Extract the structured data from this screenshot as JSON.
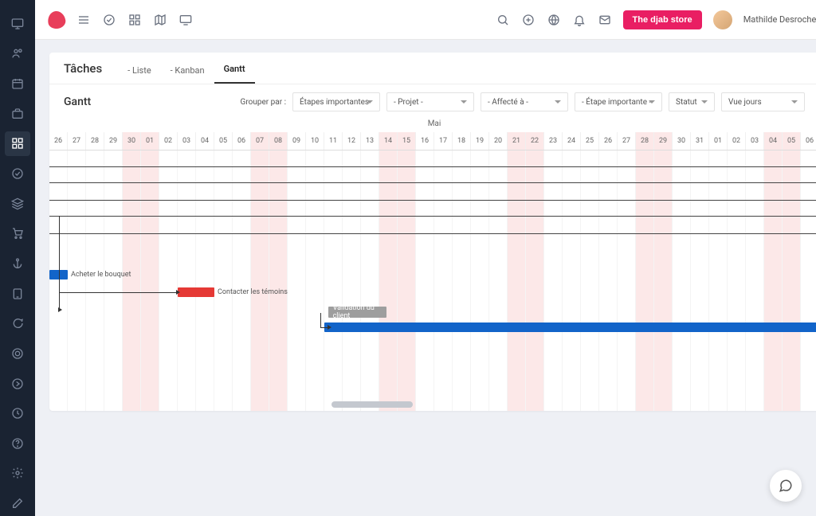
{
  "colors": {
    "accent": "#e91e63",
    "bar_blue": "#1264c9",
    "bar_red": "#e53935",
    "bar_gray": "#9e9e9e"
  },
  "header": {
    "store_button": "The djab store",
    "user_name": "Mathilde Desroches"
  },
  "sidebar_icons": [
    "monitor-icon",
    "users-icon",
    "calendar-icon",
    "briefcase-icon",
    "grid-icon",
    "check-circle-icon",
    "layers-icon",
    "cart-icon",
    "anchor-icon",
    "tablet-icon",
    "chat-icon",
    "globe-icon",
    "arrow-right-icon",
    "pie-icon",
    "help-icon",
    "settings-icon",
    "edit-icon"
  ],
  "page": {
    "title": "Tâches",
    "tabs": [
      {
        "label": "- Liste",
        "active": false
      },
      {
        "label": "- Kanban",
        "active": false
      },
      {
        "label": "Gantt",
        "active": true
      }
    ],
    "gantt_title": "Gantt"
  },
  "controls": {
    "group_by_label": "Grouper par :",
    "milestone": "Étapes importantes",
    "project": "- Projet -",
    "assignee": "- Affecté à -",
    "milestone2": "- Étape importante -",
    "status": "Statut",
    "view": "Vue jours"
  },
  "timeline": {
    "month": "Mai",
    "days": [
      "26",
      "27",
      "28",
      "29",
      "30",
      "01",
      "02",
      "03",
      "04",
      "05",
      "06",
      "07",
      "08",
      "09",
      "10",
      "11",
      "12",
      "13",
      "14",
      "15",
      "16",
      "17",
      "18",
      "19",
      "20",
      "21",
      "22",
      "23",
      "24",
      "25",
      "26",
      "27",
      "28",
      "29",
      "30",
      "31",
      "01",
      "02",
      "03",
      "04",
      "05",
      "06"
    ],
    "weekend_indices": [
      4,
      5,
      11,
      12,
      18,
      19,
      25,
      26,
      32,
      33,
      39,
      40
    ]
  },
  "tasks": [
    {
      "name": "Acheter le bouquet",
      "color": "blue",
      "start_index": 0,
      "length": 1.0
    },
    {
      "name": "Contacter les témoins",
      "color": "red",
      "start_index": 7,
      "length": 2.0
    },
    {
      "name": "Validation du client",
      "color": "gray",
      "start_index": 15.2,
      "length": 3.2
    },
    {
      "name": "",
      "color": "blue",
      "start_index": 15,
      "length": 27
    }
  ]
}
